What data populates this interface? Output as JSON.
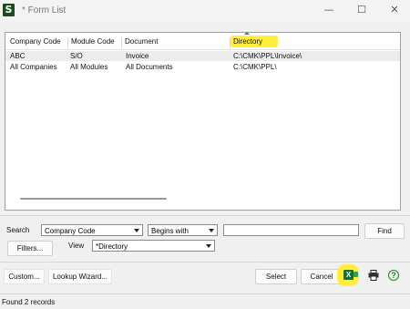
{
  "window": {
    "app_icon_glyph": "S",
    "title": "* Form List",
    "minimize_glyph": "—",
    "maximize_glyph": "☐",
    "close_glyph": "✕"
  },
  "list": {
    "columns": [
      "Company Code",
      "Module Code",
      "Document",
      "Directory"
    ],
    "sorted_column": "Directory",
    "highlight_color": "#ffef3a",
    "rows": [
      {
        "company": "ABC",
        "module": "S/O",
        "document": "Invoice",
        "directory": "C:\\CMK\\PPL\\Invoice\\"
      },
      {
        "company": "All Companies",
        "module": "All Modules",
        "document": "All Documents",
        "directory": "C:\\CMK\\PPL\\"
      }
    ]
  },
  "search": {
    "label": "Search",
    "field_value": "Company Code",
    "operator_value": "Begins with",
    "text_value": "",
    "find_label": "Find",
    "filters_label": "Filters...",
    "view_label": "View",
    "view_value": "*Directory"
  },
  "footer": {
    "custom_label": "Custom...",
    "lookup_wizard_label": "Lookup Wizard...",
    "select_label": "Select",
    "cancel_label": "Cancel",
    "excel_glyph": "X",
    "help_glyph": "?"
  },
  "status": {
    "text": "Found 2 records"
  },
  "icons": [
    "sage-app-icon",
    "excel-icon",
    "printer-icon",
    "help-icon"
  ]
}
